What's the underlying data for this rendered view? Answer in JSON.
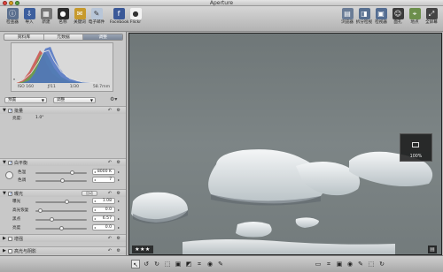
{
  "window": {
    "title": "Aperture"
  },
  "toolbar_left": [
    {
      "label": "检查器",
      "icon": "inspector-icon",
      "color": "#5b6f8e",
      "glyph": "ⓘ"
    },
    {
      "label": "导入",
      "icon": "import-icon",
      "color": "#3d5f9e",
      "glyph": "⇩"
    },
    {
      "label": "新建",
      "icon": "new-icon",
      "color": "#777777",
      "glyph": "▦"
    },
    {
      "label": "名称",
      "icon": "faces-icon",
      "color": "#2b2b2b",
      "glyph": "●"
    },
    {
      "label": "关键词",
      "icon": "keywords-icon",
      "color": "#c79a2c",
      "glyph": "✉"
    },
    {
      "label": "电子邮件",
      "icon": "email-icon",
      "color": "#b8c6d8",
      "glyph": "✎"
    },
    {
      "label": "Facebook",
      "icon": "facebook-icon",
      "color": "#3b5998",
      "glyph": "f"
    },
    {
      "label": "Flickr",
      "icon": "flickr-icon",
      "color": "#f2f2f2",
      "glyph": "●"
    }
  ],
  "toolbar_right": [
    {
      "label": "浏览器",
      "icon": "browser-icon",
      "color": "#6a7c96",
      "glyph": "▤"
    },
    {
      "label": "拆分检视",
      "icon": "split-view-icon",
      "color": "#587090",
      "glyph": "◨"
    },
    {
      "label": "检视器",
      "icon": "viewer-icon",
      "color": "#546d92",
      "glyph": "▣"
    },
    {
      "label": "面孔",
      "icon": "faces-view-icon",
      "color": "#3b3b3b",
      "glyph": "☺"
    },
    {
      "label": "地点",
      "icon": "places-icon",
      "color": "#6c8f4c",
      "glyph": "⌖"
    },
    {
      "label": "全屏幕",
      "icon": "fullscreen-icon",
      "color": "#444444",
      "glyph": "⤢"
    }
  ],
  "inspector": {
    "tabs": [
      "资料库",
      "元数据",
      "调整"
    ],
    "active_tab": "调整",
    "histogram_meta": [
      "ISO 160",
      "ƒ/11",
      "1/30",
      "58.7mm"
    ],
    "preset_label": "预置",
    "adjust_label": "调整",
    "sections": {
      "raw": {
        "name": "批量",
        "sub_label": "亮度:",
        "sub_value": "1.0°"
      },
      "white_balance": {
        "name": "白平衡",
        "params": [
          {
            "label": "色温",
            "value": "8000 K",
            "knob": 0.72
          },
          {
            "label": "色调",
            "value": "7",
            "knob": 0.52
          }
        ]
      },
      "exposure": {
        "name": "曝光",
        "auto_label": "自动",
        "params": [
          {
            "label": "曝光",
            "value": "1.08",
            "knob": 0.62
          },
          {
            "label": "高光恢复",
            "value": "0.0",
            "knob": 0.05
          },
          {
            "label": "黑点",
            "value": "6.57",
            "knob": 0.3
          },
          {
            "label": "亮度",
            "value": "0.0",
            "knob": 0.5
          }
        ]
      },
      "enhance": {
        "name": "增强"
      },
      "highlights_shadows": {
        "name": "高光与阴影"
      },
      "levels": {
        "name": "色阶",
        "auto_label": "自动"
      },
      "color": {
        "name": "颜色"
      }
    }
  },
  "viewer": {
    "rating": "★★★",
    "zoom": "100%"
  },
  "bottom_tools": [
    {
      "icon": "select-tool-icon",
      "glyph": "↖"
    },
    {
      "icon": "rotate-left-icon",
      "glyph": "↺"
    },
    {
      "icon": "rotate-right-icon",
      "glyph": "↻"
    },
    {
      "icon": "lift-tool-icon",
      "glyph": "⬚"
    },
    {
      "icon": "stamp-tool-icon",
      "glyph": "▣"
    },
    {
      "icon": "straighten-tool-icon",
      "glyph": "◩"
    },
    {
      "icon": "crop-tool-icon",
      "glyph": "⌗"
    },
    {
      "icon": "redeye-tool-icon",
      "glyph": "◉"
    },
    {
      "icon": "brush-tool-icon",
      "glyph": "✎"
    }
  ],
  "bottom_right_tools": [
    {
      "icon": "thumbnail-icon",
      "glyph": "▭"
    },
    {
      "icon": "crop2-icon",
      "glyph": "⌗"
    },
    {
      "icon": "stamp2-icon",
      "glyph": "▣"
    },
    {
      "icon": "eye-icon",
      "glyph": "◉"
    },
    {
      "icon": "pencil-icon",
      "glyph": "✎"
    },
    {
      "icon": "lift2-icon",
      "glyph": "⬚"
    },
    {
      "icon": "rotate2-icon",
      "glyph": "↻"
    }
  ],
  "colors": {
    "window_bg": "#b9b9b9",
    "active_tab": "#8490a3",
    "viewer_bg": "#3a3a3a"
  }
}
